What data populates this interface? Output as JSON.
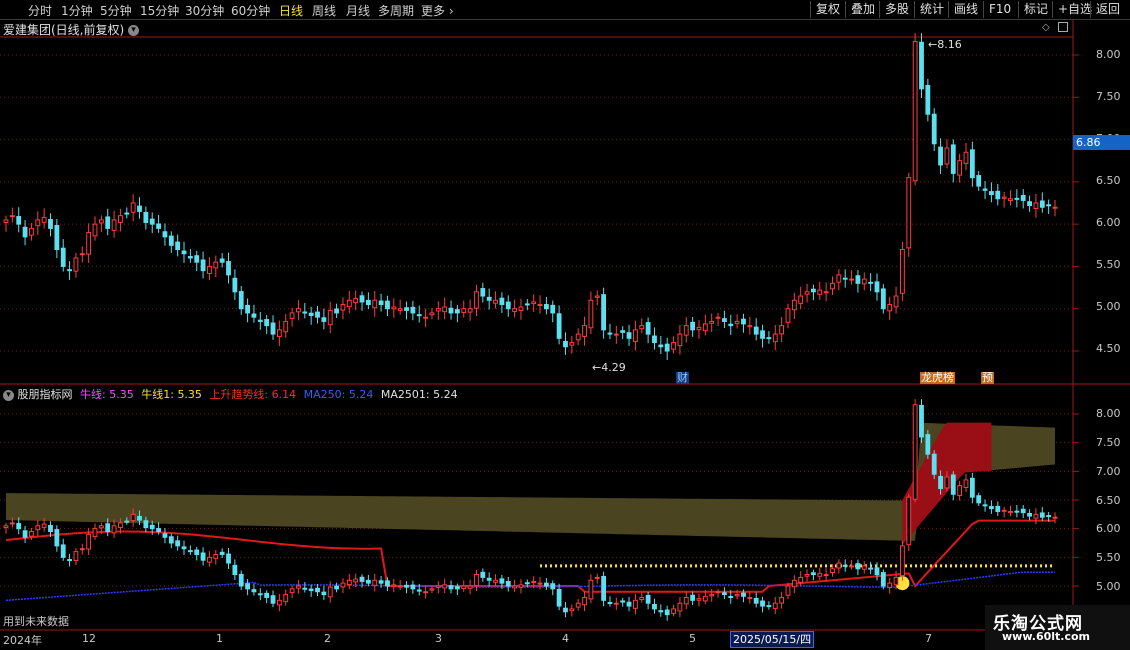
{
  "tabs": [
    {
      "label": "分时",
      "active": false
    },
    {
      "label": "1分钟",
      "active": false
    },
    {
      "label": "5分钟",
      "active": false
    },
    {
      "label": "15分钟",
      "active": false
    },
    {
      "label": "30分钟",
      "active": false
    },
    {
      "label": "60分钟",
      "active": false
    },
    {
      "label": "日线",
      "active": true
    },
    {
      "label": "周线",
      "active": false
    },
    {
      "label": "月线",
      "active": false
    },
    {
      "label": "多周期",
      "active": false
    },
    {
      "label": "更多",
      "active": false
    }
  ],
  "right_buttons": [
    "复权",
    "叠加",
    "多股",
    "统计",
    "画线",
    "F10",
    "标记",
    "+自选",
    "返回"
  ],
  "main_title": "爱建集团(日线,前复权)",
  "current_price": "6.86",
  "price_axis": [
    "8.00",
    "7.50",
    "7.00",
    "6.50",
    "6.00",
    "5.50",
    "5.00",
    "4.50"
  ],
  "annotations": {
    "high": "8.16",
    "low": "4.29",
    "fin_badge": "财",
    "rank_badge": "龙虎榜",
    "pred_badge": "预",
    "future_text": "用到未来数据"
  },
  "indicator": {
    "name": "股朋指标网",
    "items": [
      {
        "label": "牛线:",
        "value": "5.35",
        "color": "#ff4cff"
      },
      {
        "label": "牛线1:",
        "value": "5.35",
        "color": "#ffdf3a"
      },
      {
        "label": "上升趋势线:",
        "value": "6.14",
        "color": "#ff2a2a"
      },
      {
        "label": "MA250:",
        "value": "5.24",
        "color": "#3a5cff"
      },
      {
        "label": "MA2501:",
        "value": "5.24",
        "color": "#e0e0e0"
      }
    ]
  },
  "indicator_axis": [
    "8.00",
    "7.50",
    "7.00",
    "6.50",
    "6.00",
    "5.50",
    "5.00"
  ],
  "x_labels": [
    "2024年",
    "12",
    "1",
    "2",
    "3",
    "4",
    "5",
    "7"
  ],
  "date_highlight": "2025/05/15/四",
  "watermark": {
    "title": "乐淘公式网",
    "url": "www.60lt.com"
  },
  "colors": {
    "up": "#ff3c3c",
    "down": "#5ce0f0",
    "grid": "#7a1a1a",
    "axis": "#a01818",
    "accent": "#ffdf3a"
  },
  "chart_data": {
    "type": "candlestick",
    "title": "爱建集团(日线,前复权)",
    "ylim": [
      4.2,
      8.4
    ],
    "high_label": 8.16,
    "low_label": 4.29,
    "last_price": 6.86,
    "closes": [
      6.05,
      6.1,
      6.0,
      5.85,
      5.95,
      6.05,
      6.08,
      5.95,
      5.7,
      5.5,
      5.45,
      5.6,
      5.65,
      5.9,
      6.0,
      6.05,
      5.95,
      6.05,
      6.1,
      6.12,
      6.25,
      6.15,
      6.02,
      6.0,
      5.95,
      5.85,
      5.75,
      5.7,
      5.65,
      5.6,
      5.55,
      5.45,
      5.5,
      5.55,
      5.55,
      5.4,
      5.2,
      5.0,
      4.95,
      4.9,
      4.85,
      4.8,
      4.7,
      4.75,
      4.85,
      4.95,
      5.0,
      4.95,
      4.92,
      4.9,
      4.85,
      4.98,
      4.95,
      5.05,
      5.1,
      5.12,
      5.08,
      5.05,
      5.1,
      5.05,
      5.0,
      5.02,
      5.0,
      4.98,
      4.95,
      4.92,
      4.9,
      4.95,
      5.0,
      5.02,
      4.95,
      4.95,
      5.0,
      5.0,
      5.2,
      5.15,
      5.1,
      5.1,
      5.05,
      5.0,
      5.0,
      5.02,
      5.05,
      5.08,
      5.05,
      5.0,
      4.95,
      4.65,
      4.55,
      4.6,
      4.7,
      4.8,
      5.1,
      5.15,
      4.75,
      4.7,
      4.7,
      4.72,
      4.65,
      4.75,
      4.8,
      4.7,
      4.6,
      4.55,
      4.5,
      4.6,
      4.7,
      4.8,
      4.75,
      4.78,
      4.82,
      4.85,
      4.9,
      4.85,
      4.8,
      4.85,
      4.82,
      4.8,
      4.7,
      4.65,
      4.65,
      4.7,
      4.8,
      5.0,
      5.1,
      5.15,
      5.2,
      5.2,
      5.22,
      5.2,
      5.3,
      5.4,
      5.35,
      5.35,
      5.3,
      5.35,
      5.3,
      5.2,
      5.0,
      5.05,
      5.15,
      5.7,
      6.55,
      8.16,
      7.6,
      7.3,
      6.95,
      6.7,
      6.9,
      6.6,
      6.75,
      6.85,
      6.55,
      6.45,
      6.4,
      6.35,
      6.3,
      6.32,
      6.3,
      6.3,
      6.28,
      6.22,
      6.25,
      6.2,
      6.22,
      6.2
    ]
  }
}
